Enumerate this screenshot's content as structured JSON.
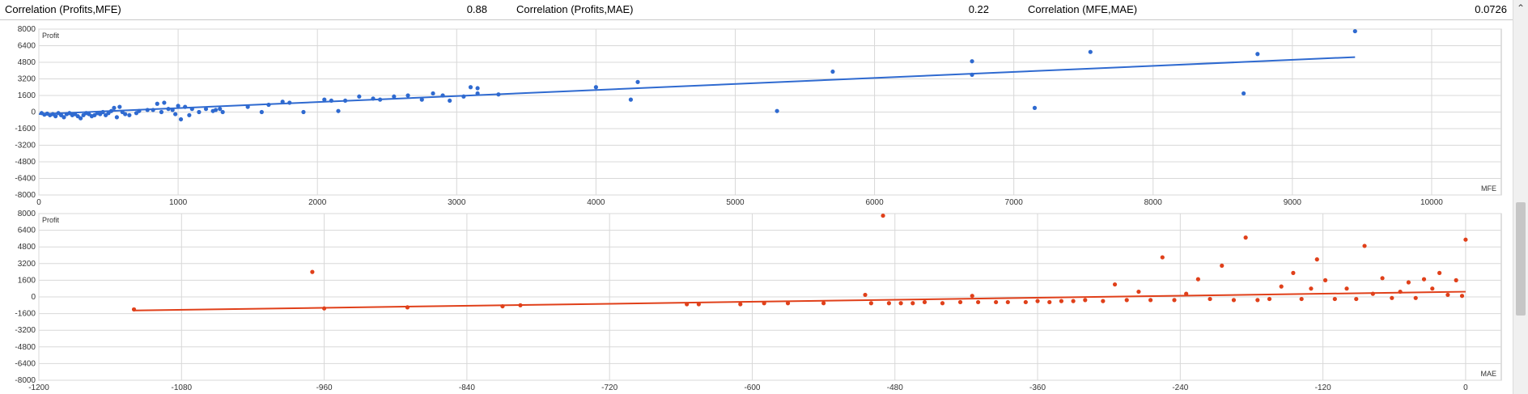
{
  "header": {
    "metrics": [
      {
        "label": "Correlation (Profits,MFE)",
        "value": "0.88"
      },
      {
        "label": "Correlation (Profits,MAE)",
        "value": "0.22"
      },
      {
        "label": "Correlation (MFE,MAE)",
        "value": "0.0726"
      }
    ]
  },
  "colors": {
    "top_series": "#2f6ad0",
    "bottom_series": "#e0401a",
    "grid": "#d8d8d8"
  },
  "chart_data": [
    {
      "type": "scatter",
      "xlabel": "MFE",
      "ylabel": "Profit",
      "xlim": [
        0,
        10500
      ],
      "ylim": [
        -8000,
        8000
      ],
      "xticks": [
        0,
        1000,
        2000,
        3000,
        4000,
        5000,
        6000,
        7000,
        8000,
        9000,
        10000
      ],
      "yticks": [
        -8000,
        -6400,
        -4800,
        -3200,
        -1600,
        0,
        1600,
        3200,
        4800,
        6400,
        8000
      ],
      "grid": true,
      "trendline": {
        "x": [
          0,
          9450
        ],
        "y": [
          -200,
          5300
        ]
      },
      "points": [
        {
          "x": 20,
          "y": -100
        },
        {
          "x": 40,
          "y": -250
        },
        {
          "x": 60,
          "y": -150
        },
        {
          "x": 80,
          "y": -300
        },
        {
          "x": 100,
          "y": -200
        },
        {
          "x": 120,
          "y": -400
        },
        {
          "x": 140,
          "y": -100
        },
        {
          "x": 160,
          "y": -300
        },
        {
          "x": 180,
          "y": -500
        },
        {
          "x": 200,
          "y": -200
        },
        {
          "x": 220,
          "y": -100
        },
        {
          "x": 240,
          "y": -300
        },
        {
          "x": 260,
          "y": -200
        },
        {
          "x": 280,
          "y": -400
        },
        {
          "x": 300,
          "y": -600
        },
        {
          "x": 320,
          "y": -300
        },
        {
          "x": 340,
          "y": -100
        },
        {
          "x": 360,
          "y": -200
        },
        {
          "x": 380,
          "y": -400
        },
        {
          "x": 400,
          "y": -300
        },
        {
          "x": 420,
          "y": -100
        },
        {
          "x": 440,
          "y": -200
        },
        {
          "x": 460,
          "y": 0
        },
        {
          "x": 480,
          "y": -300
        },
        {
          "x": 500,
          "y": -100
        },
        {
          "x": 520,
          "y": 100
        },
        {
          "x": 540,
          "y": 400
        },
        {
          "x": 560,
          "y": -500
        },
        {
          "x": 580,
          "y": 500
        },
        {
          "x": 600,
          "y": 0
        },
        {
          "x": 620,
          "y": -200
        },
        {
          "x": 650,
          "y": -300
        },
        {
          "x": 700,
          "y": -100
        },
        {
          "x": 720,
          "y": 100
        },
        {
          "x": 780,
          "y": 200
        },
        {
          "x": 820,
          "y": 200
        },
        {
          "x": 850,
          "y": 800
        },
        {
          "x": 880,
          "y": 0
        },
        {
          "x": 900,
          "y": 900
        },
        {
          "x": 930,
          "y": 300
        },
        {
          "x": 960,
          "y": 200
        },
        {
          "x": 980,
          "y": -200
        },
        {
          "x": 1000,
          "y": 600
        },
        {
          "x": 1020,
          "y": -700
        },
        {
          "x": 1050,
          "y": 500
        },
        {
          "x": 1080,
          "y": -300
        },
        {
          "x": 1100,
          "y": 300
        },
        {
          "x": 1150,
          "y": 0
        },
        {
          "x": 1200,
          "y": 300
        },
        {
          "x": 1250,
          "y": 100
        },
        {
          "x": 1270,
          "y": 200
        },
        {
          "x": 1300,
          "y": 300
        },
        {
          "x": 1320,
          "y": 0
        },
        {
          "x": 1500,
          "y": 500
        },
        {
          "x": 1600,
          "y": 0
        },
        {
          "x": 1650,
          "y": 700
        },
        {
          "x": 1750,
          "y": 1000
        },
        {
          "x": 1800,
          "y": 900
        },
        {
          "x": 1900,
          "y": 0
        },
        {
          "x": 2050,
          "y": 1200
        },
        {
          "x": 2100,
          "y": 1100
        },
        {
          "x": 2150,
          "y": 100
        },
        {
          "x": 2200,
          "y": 1100
        },
        {
          "x": 2300,
          "y": 1500
        },
        {
          "x": 2400,
          "y": 1300
        },
        {
          "x": 2450,
          "y": 1200
        },
        {
          "x": 2550,
          "y": 1500
        },
        {
          "x": 2650,
          "y": 1600
        },
        {
          "x": 2750,
          "y": 1200
        },
        {
          "x": 2830,
          "y": 1800
        },
        {
          "x": 2900,
          "y": 1600
        },
        {
          "x": 2950,
          "y": 1100
        },
        {
          "x": 3050,
          "y": 1500
        },
        {
          "x": 3100,
          "y": 2400
        },
        {
          "x": 3150,
          "y": 1800
        },
        {
          "x": 3150,
          "y": 2300
        },
        {
          "x": 3300,
          "y": 1700
        },
        {
          "x": 4000,
          "y": 2400
        },
        {
          "x": 4250,
          "y": 1200
        },
        {
          "x": 4300,
          "y": 2900
        },
        {
          "x": 5300,
          "y": 100
        },
        {
          "x": 5700,
          "y": 3900
        },
        {
          "x": 6700,
          "y": 3600
        },
        {
          "x": 6700,
          "y": 4900
        },
        {
          "x": 7150,
          "y": 400
        },
        {
          "x": 7550,
          "y": 5800
        },
        {
          "x": 8650,
          "y": 1800
        },
        {
          "x": 8750,
          "y": 5600
        },
        {
          "x": 9450,
          "y": 7800
        }
      ]
    },
    {
      "type": "scatter",
      "xlabel": "MAE",
      "ylabel": "Profit",
      "xlim": [
        -1200,
        30
      ],
      "ylim": [
        -8000,
        8000
      ],
      "xticks": [
        -1200,
        -1080,
        -960,
        -840,
        -720,
        -600,
        -480,
        -360,
        -240,
        -120,
        0
      ],
      "yticks": [
        -8000,
        -6400,
        -4800,
        -3200,
        -1600,
        0,
        1600,
        3200,
        4800,
        6400,
        8000
      ],
      "grid": true,
      "trendline": {
        "x": [
          -1120,
          0
        ],
        "y": [
          -1300,
          500
        ]
      },
      "points": [
        {
          "x": -1120,
          "y": -1200
        },
        {
          "x": -970,
          "y": 2400
        },
        {
          "x": -960,
          "y": -1100
        },
        {
          "x": -890,
          "y": -1000
        },
        {
          "x": -810,
          "y": -900
        },
        {
          "x": -795,
          "y": -800
        },
        {
          "x": -655,
          "y": -700
        },
        {
          "x": -645,
          "y": -700
        },
        {
          "x": -610,
          "y": -700
        },
        {
          "x": -590,
          "y": -600
        },
        {
          "x": -570,
          "y": -600
        },
        {
          "x": -540,
          "y": -600
        },
        {
          "x": -505,
          "y": 200
        },
        {
          "x": -500,
          "y": -600
        },
        {
          "x": -490,
          "y": 7800
        },
        {
          "x": -485,
          "y": -600
        },
        {
          "x": -475,
          "y": -600
        },
        {
          "x": -465,
          "y": -600
        },
        {
          "x": -455,
          "y": -500
        },
        {
          "x": -440,
          "y": -600
        },
        {
          "x": -425,
          "y": -500
        },
        {
          "x": -415,
          "y": 100
        },
        {
          "x": -410,
          "y": -500
        },
        {
          "x": -395,
          "y": -500
        },
        {
          "x": -385,
          "y": -500
        },
        {
          "x": -370,
          "y": -500
        },
        {
          "x": -360,
          "y": -400
        },
        {
          "x": -350,
          "y": -500
        },
        {
          "x": -340,
          "y": -400
        },
        {
          "x": -330,
          "y": -400
        },
        {
          "x": -320,
          "y": -300
        },
        {
          "x": -305,
          "y": -400
        },
        {
          "x": -295,
          "y": 1200
        },
        {
          "x": -285,
          "y": -300
        },
        {
          "x": -275,
          "y": 500
        },
        {
          "x": -265,
          "y": -300
        },
        {
          "x": -255,
          "y": 3800
        },
        {
          "x": -245,
          "y": -300
        },
        {
          "x": -235,
          "y": 300
        },
        {
          "x": -225,
          "y": 1700
        },
        {
          "x": -215,
          "y": -200
        },
        {
          "x": -205,
          "y": 3000
        },
        {
          "x": -195,
          "y": -300
        },
        {
          "x": -185,
          "y": 5700
        },
        {
          "x": -175,
          "y": -300
        },
        {
          "x": -165,
          "y": -200
        },
        {
          "x": -155,
          "y": 1000
        },
        {
          "x": -145,
          "y": 2300
        },
        {
          "x": -138,
          "y": -200
        },
        {
          "x": -130,
          "y": 800
        },
        {
          "x": -125,
          "y": 3600
        },
        {
          "x": -118,
          "y": 1600
        },
        {
          "x": -110,
          "y": -200
        },
        {
          "x": -100,
          "y": 800
        },
        {
          "x": -92,
          "y": -200
        },
        {
          "x": -85,
          "y": 4900
        },
        {
          "x": -78,
          "y": 300
        },
        {
          "x": -70,
          "y": 1800
        },
        {
          "x": -62,
          "y": -100
        },
        {
          "x": -55,
          "y": 500
        },
        {
          "x": -48,
          "y": 1400
        },
        {
          "x": -42,
          "y": -100
        },
        {
          "x": -35,
          "y": 1700
        },
        {
          "x": -28,
          "y": 800
        },
        {
          "x": -22,
          "y": 2300
        },
        {
          "x": -15,
          "y": 200
        },
        {
          "x": -8,
          "y": 1600
        },
        {
          "x": -3,
          "y": 100
        },
        {
          "x": 0,
          "y": 5500
        }
      ]
    }
  ]
}
